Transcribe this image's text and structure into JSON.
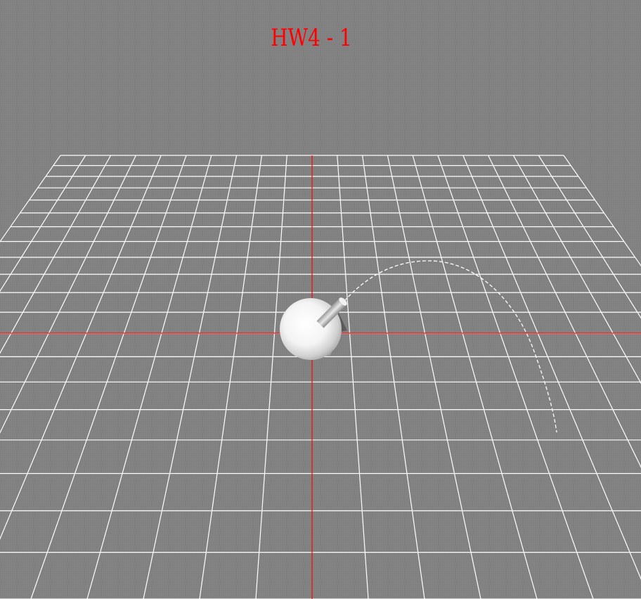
{
  "title": "HW4 - 1",
  "colors": {
    "background": "#828282",
    "title": "#ff0000",
    "grid": "#ffffff",
    "axes": "#ff0000",
    "trajectory": "#ffffff"
  },
  "scene": {
    "objects": [
      {
        "name": "cannon-sphere",
        "shape": "sphere",
        "color": "#ffffff"
      },
      {
        "name": "cannon-barrel",
        "shape": "cylinder",
        "color": "#d0d0d0"
      }
    ],
    "trajectory_style": "dashed"
  }
}
